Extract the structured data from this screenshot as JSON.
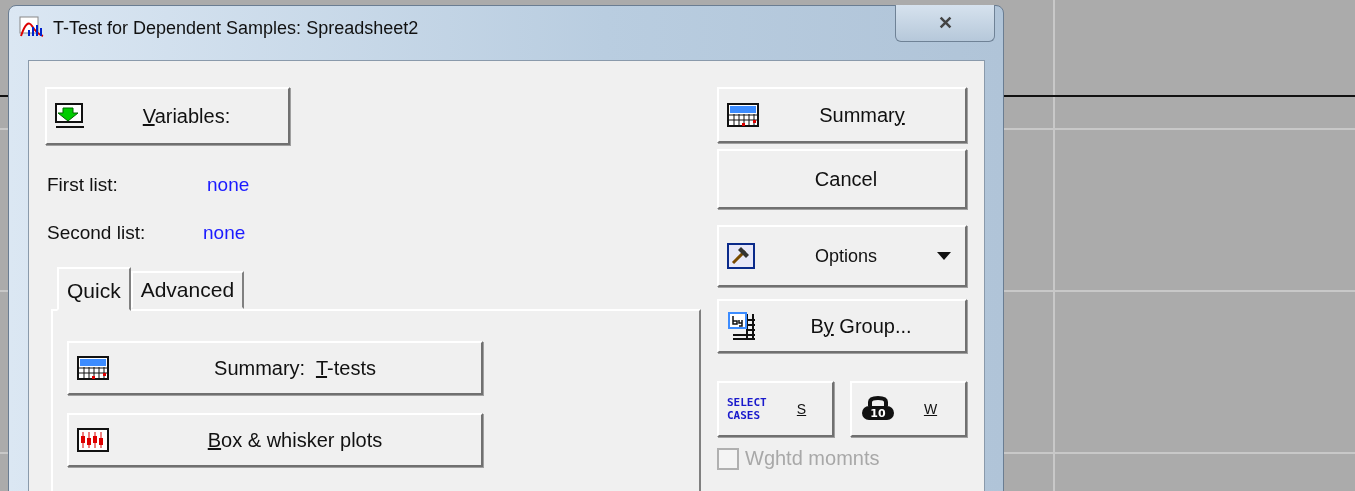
{
  "window": {
    "title": "T-Test for Dependent Samples: Spreadsheet2",
    "close": "✕"
  },
  "variables_button": {
    "label": [
      {
        "text": "V",
        "underline": true
      },
      {
        "text": "ariables:",
        "underline": false
      }
    ]
  },
  "lists": [
    {
      "label": "First list:",
      "value": "none"
    },
    {
      "label": "Second list:",
      "value": "none"
    }
  ],
  "tabs": [
    {
      "label": "Quick",
      "selected": true
    },
    {
      "label": "Advanced",
      "selected": false
    }
  ],
  "quick_buttons": [
    {
      "kind": "summary",
      "label": [
        {
          "text": "Summary:  ",
          "underline": false
        },
        {
          "text": "T",
          "underline": true
        },
        {
          "text": "-tests",
          "underline": false
        }
      ]
    },
    {
      "kind": "boxplot",
      "label": [
        {
          "text": "B",
          "underline": true
        },
        {
          "text": "ox & whisker plots",
          "underline": false
        }
      ]
    }
  ],
  "side_buttons": [
    {
      "kind": "summary",
      "label": [
        {
          "text": "Summar",
          "underline": false
        },
        {
          "text": "y",
          "underline": true
        }
      ]
    },
    {
      "kind": "plain",
      "label": [
        {
          "text": "Cancel",
          "underline": false
        }
      ]
    },
    {
      "kind": "options",
      "label": [
        {
          "text": "Options",
          "underline": false
        }
      ]
    },
    {
      "kind": "bygroup",
      "label": [
        {
          "text": "B",
          "underline": false
        },
        {
          "text": "y",
          "underline": true
        },
        {
          "text": " Group...",
          "underline": false
        }
      ]
    }
  ],
  "small_buttons": [
    {
      "kind": "select",
      "icon_text": "SELECT CASES",
      "label": [
        {
          "text": "S",
          "underline": true
        }
      ]
    },
    {
      "kind": "weight",
      "icon_text": "10",
      "label": [
        {
          "text": "W",
          "underline": true
        }
      ]
    }
  ],
  "checkbox": {
    "label": "Wghtd momnts",
    "checked": false,
    "disabled": true
  }
}
